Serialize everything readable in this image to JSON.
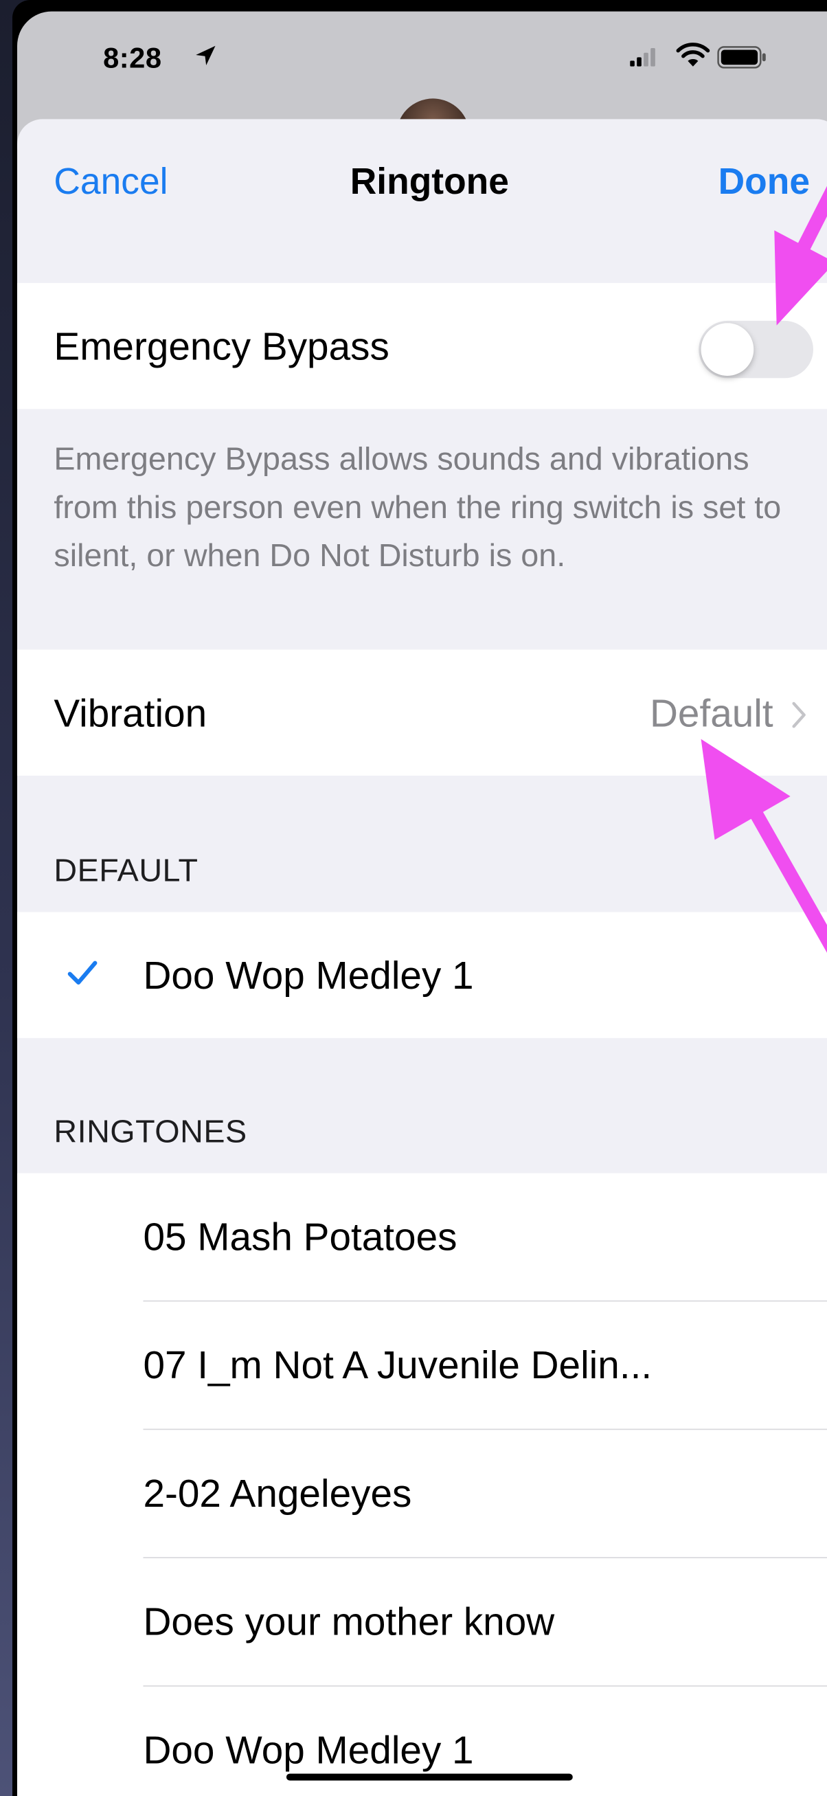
{
  "status_bar": {
    "time": "8:28"
  },
  "nav": {
    "cancel_label": "Cancel",
    "title": "Ringtone",
    "done_label": "Done"
  },
  "emergency_bypass": {
    "label": "Emergency Bypass",
    "enabled": false,
    "footer": "Emergency Bypass allows sounds and vibrations from this person even when the ring switch is set to silent, or when Do Not Disturb is on."
  },
  "vibration": {
    "label": "Vibration",
    "value": "Default"
  },
  "default_section": {
    "header": "DEFAULT",
    "selected_label": "Doo Wop Medley 1"
  },
  "ringtones_section": {
    "header": "RINGTONES",
    "items": [
      {
        "label": "05 Mash Potatoes"
      },
      {
        "label": "07 I_m Not A Juvenile Delin..."
      },
      {
        "label": "2-02 Angeleyes"
      },
      {
        "label": "Does your mother know"
      },
      {
        "label": "Doo Wop Medley 1"
      }
    ]
  },
  "colors": {
    "accent": "#1a7cf0",
    "annotation_arrow": "#f04ef0",
    "sheet_background": "#f0f0f6",
    "cell_background": "#ffffff",
    "secondary_text": "#7d7d82"
  },
  "icons": {
    "location": "location-arrow-icon",
    "signal": "cellular-signal-icon",
    "wifi": "wifi-icon",
    "battery": "battery-icon",
    "chevron": "chevron-right-icon",
    "checkmark": "checkmark-icon"
  }
}
